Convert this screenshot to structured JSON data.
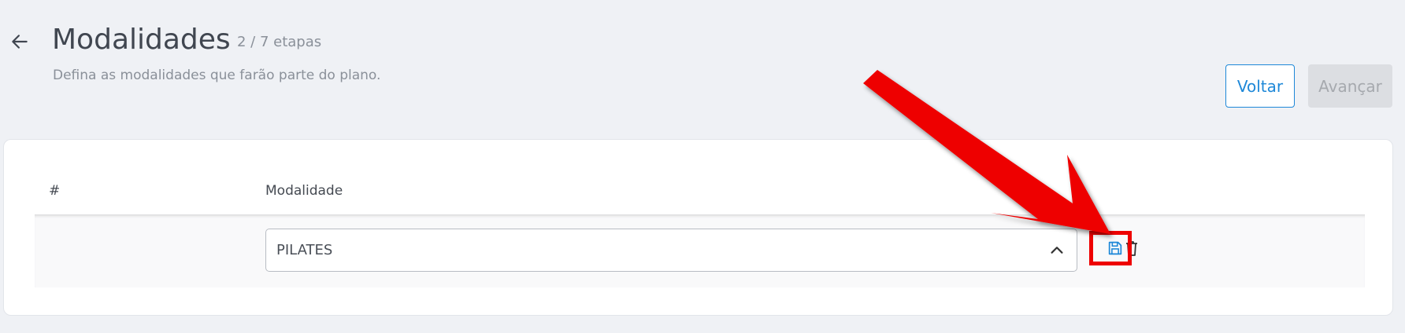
{
  "header": {
    "back_icon": "arrow-left-icon",
    "title": "Modalidades",
    "steps": "2 / 7 etapas",
    "subtitle": "Defina as modalidades que farão parte do plano."
  },
  "actions": {
    "voltar_label": "Voltar",
    "avancar_label": "Avançar"
  },
  "table": {
    "columns": [
      "#",
      "Modalidade"
    ],
    "rows": [
      {
        "index": "",
        "modalidade": "PILATES",
        "select_icon": "chevron-up-icon",
        "row_actions": [
          "save-icon",
          "trash-icon"
        ]
      }
    ]
  },
  "colors": {
    "accent": "#1e88d8",
    "background": "#eff1f5",
    "annotation": "#ee0000"
  }
}
